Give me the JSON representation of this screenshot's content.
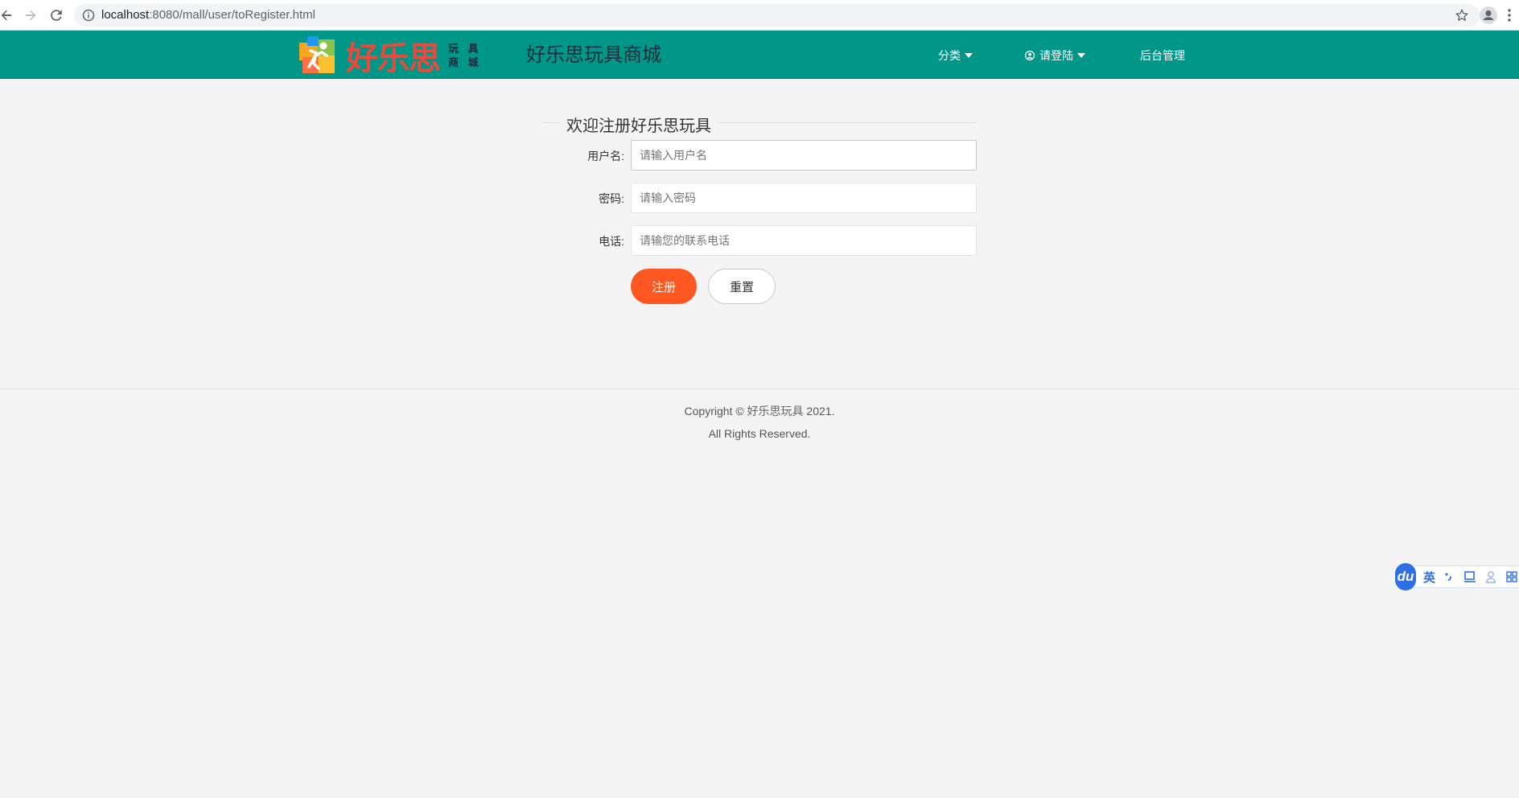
{
  "browser": {
    "url_host": "localhost",
    "url_path": ":8080/mall/user/toRegister.html"
  },
  "header": {
    "logo_text": "好乐思",
    "logo_sub_line1": "玩 具",
    "logo_sub_line2": "商 城",
    "site_title": "好乐思玩具商城",
    "nav": {
      "category": "分类",
      "login": "请登陆",
      "admin": "后台管理"
    }
  },
  "form": {
    "legend": "欢迎注册好乐思玩具",
    "username": {
      "label": "用户名:",
      "placeholder": "请输入用户名",
      "value": ""
    },
    "password": {
      "label": "密码:",
      "placeholder": "请输入密码",
      "value": ""
    },
    "phone": {
      "label": "电话:",
      "placeholder": "请输您的联系电话",
      "value": ""
    },
    "submit_label": "注册",
    "reset_label": "重置"
  },
  "footer": {
    "copyright_prefix": "Copyright © ",
    "copyright_brand": "好乐思玩具",
    "copyright_year": " 2021.",
    "rights": "All Rights Reserved."
  },
  "ime": {
    "logo": "du",
    "mode": "英"
  },
  "colors": {
    "header_bg": "#009688",
    "primary_button": "#ff5722",
    "page_bg": "#f4f4f4",
    "logo_red": "#e84b3c"
  }
}
